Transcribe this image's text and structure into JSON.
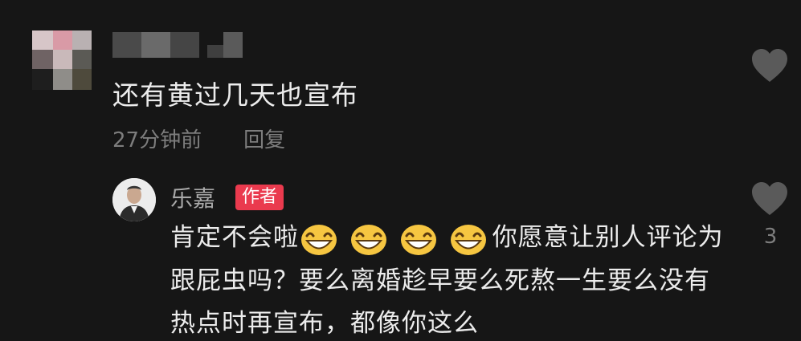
{
  "comment": {
    "text": "还有黄过几天也宣布",
    "time": "27分钟前",
    "reply_label": "回复",
    "avatar_icon": "blurred-avatar-icon",
    "like_icon": "heart-icon"
  },
  "reply": {
    "author": "乐嘉",
    "badge": "作者",
    "text_before_emoji": "肯定不会啦",
    "emoji": "grinning-face-emoji",
    "emoji_count": 4,
    "text_after_emoji": "你愿意让别人评论为跟屁虫吗？要么离婚趁早要么死熬一生要么没有热点时再宣布，都像你这么",
    "likes": "3",
    "like_icon": "heart-icon"
  },
  "colors": {
    "background": "#161616",
    "text_primary": "#ececec",
    "text_secondary": "#7d7d7d",
    "author_name": "#a9a9a9",
    "badge_bg": "#ea3a4e",
    "heart": "#5a5a5a"
  }
}
